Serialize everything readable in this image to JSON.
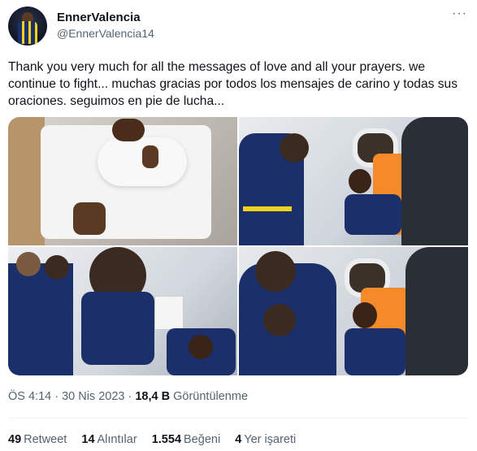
{
  "author": {
    "name": "EnnerValencia",
    "handle": "@EnnerValencia14"
  },
  "more_label": "···",
  "tweet_text": "Thank you very much for all the messages of love and all your prayers. we continue to fight... muchas gracias por todos los mensajes de carino y todas sus oraciones. seguimos en pie de lucha...",
  "meta": {
    "time_date": "ÖS 4:14 · 30 Nis 2023 · ",
    "views_count": "18,4 B",
    "views_label": " Görüntülenme"
  },
  "stats": [
    {
      "count": "49",
      "label": "Retweet"
    },
    {
      "count": "14",
      "label": "Alıntılar"
    },
    {
      "count": "1.554",
      "label": "Beğeni"
    },
    {
      "count": "4",
      "label": "Yer işareti"
    }
  ],
  "colors": {
    "text": "#0f1419",
    "secondary": "#536471",
    "divider": "#eff3f4",
    "fenerbahce_navy": "#1b2f6b",
    "fenerbahce_yellow": "#f2d21b"
  }
}
